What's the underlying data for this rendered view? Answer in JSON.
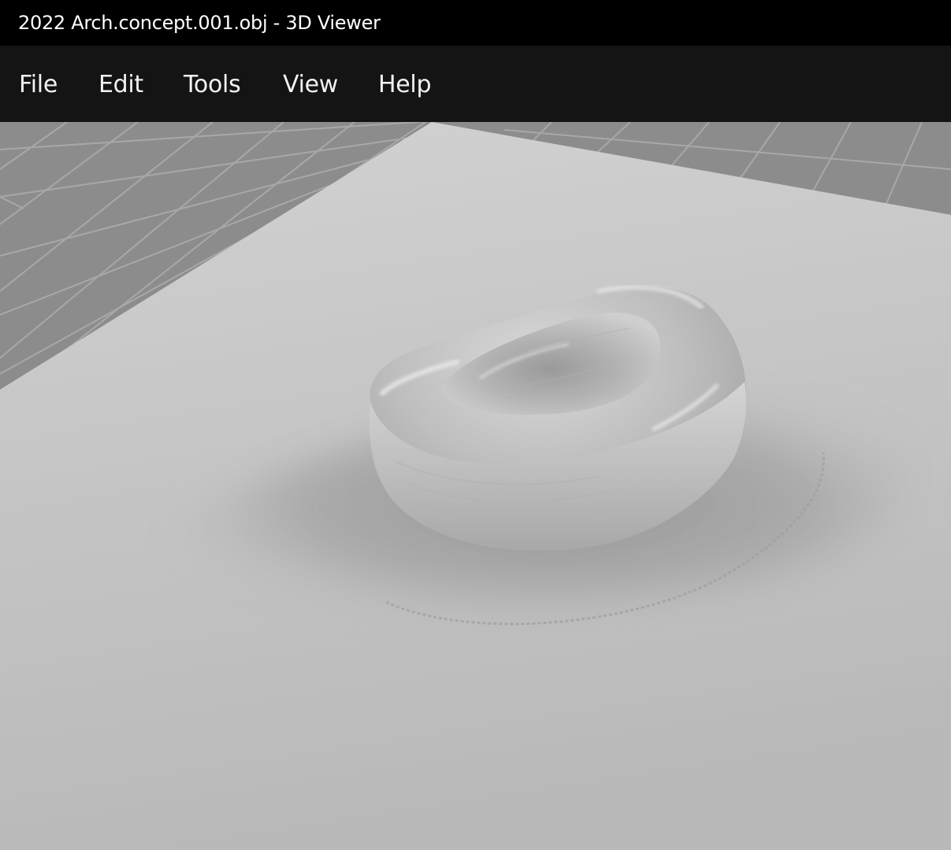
{
  "window": {
    "title": "2022 Arch.concept.001.obj - 3D Viewer"
  },
  "menu": {
    "items": [
      {
        "label": "File"
      },
      {
        "label": "Edit"
      },
      {
        "label": "Tools"
      },
      {
        "label": "View"
      },
      {
        "label": "Help"
      }
    ]
  },
  "viewport": {
    "grid_color": "#8d8d8d",
    "grid_line_color": "#a9a9a9",
    "ground_plane_color": "#c9c9c9",
    "model_color": "#bdbdbd"
  }
}
